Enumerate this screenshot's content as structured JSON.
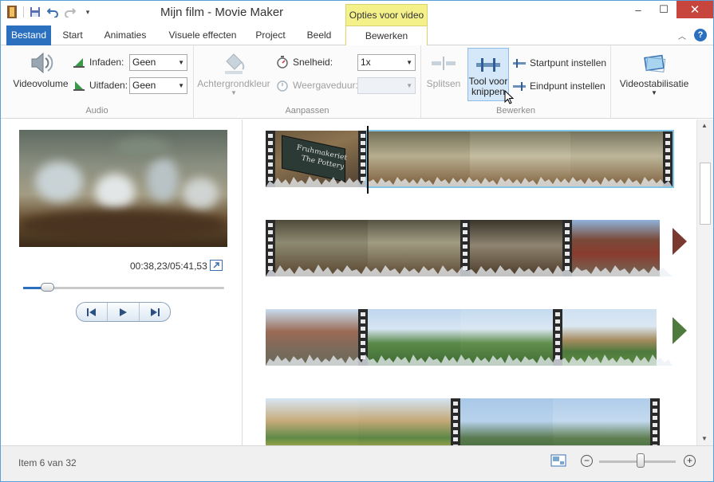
{
  "titlebar": {
    "title": "Mijn film - Movie Maker",
    "context_tab_header": "Opties voor video",
    "minimize": "–",
    "maximize": "☐",
    "close": "✕"
  },
  "tabs": [
    {
      "label": "Bestand"
    },
    {
      "label": "Start"
    },
    {
      "label": "Animaties"
    },
    {
      "label": "Visuele effecten"
    },
    {
      "label": "Project"
    },
    {
      "label": "Beeld"
    },
    {
      "label": "Bewerken"
    }
  ],
  "ribbon": {
    "audio": {
      "label": "Audio",
      "videovolume": "Videovolume",
      "infaden_label": "Infaden:",
      "infaden_value": "Geen",
      "uitfaden_label": "Uitfaden:",
      "uitfaden_value": "Geen"
    },
    "aanpassen": {
      "label": "Aanpassen",
      "achtergrondkleur": "Achtergrondkleur",
      "snelheid_label": "Snelheid:",
      "snelheid_value": "1x",
      "weergaveduur_label": "Weergaveduur:",
      "weergaveduur_value": ""
    },
    "bewerken": {
      "label": "Bewerken",
      "splitsen": "Splitsen",
      "tool_line1": "Tool voor",
      "tool_line2": "knippen",
      "startpunt": "Startpunt instellen",
      "eindpunt": "Eindpunt instellen"
    },
    "stabilisatie": {
      "videostabilisatie": "Videostabilisatie"
    }
  },
  "preview": {
    "timecode": "00:38,23/05:41,53",
    "seek_fraction": 0.12
  },
  "storyboard": {
    "sign_line1": "Fruhmakeriet",
    "sign_line2": "The Pottery"
  },
  "status": {
    "item_text": "Item 6 van 32",
    "zoom_fraction": 0.5
  },
  "colors": {
    "accent": "#2b6fbf",
    "context_tab": "#f4f18a",
    "selection": "#7fc6e8",
    "close_button": "#c7453c"
  }
}
